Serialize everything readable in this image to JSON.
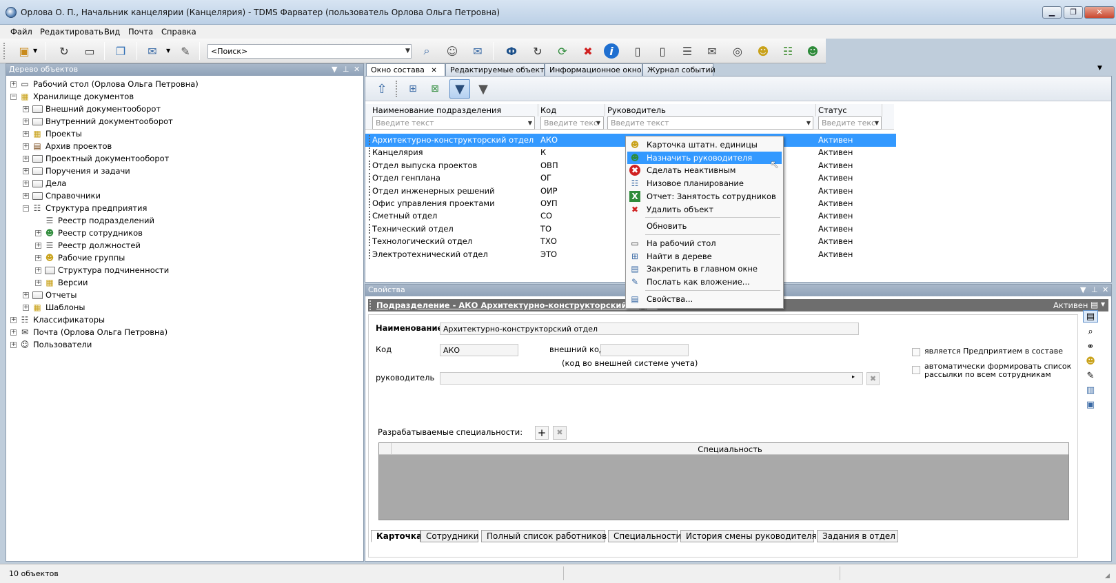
{
  "window": {
    "title": "Орлова О. П., Начальник канцелярии (Канцелярия) - TDMS Фарватер (пользователь Орлова Ольга Петровна)",
    "minimize": "▁",
    "maximize": "❐",
    "close": "✕"
  },
  "menu": [
    "Файл",
    "Редактировать",
    "Вид",
    "Почта",
    "Справка"
  ],
  "toolbar": {
    "search_placeholder": "<Поиск>",
    "icons": [
      "new-object-icon",
      "refresh-icon",
      "desktop-icon",
      "copy-object-icon",
      "send-mail-icon",
      "attach-icon",
      "search-objects-icon",
      "find-user-icon",
      "mail-search-icon",
      "faravter-logo-icon",
      "reload-icon",
      "users-sync-icon",
      "cancel-icon",
      "info-icon",
      "document-icon",
      "page-icon",
      "message-icon",
      "envelope-icon",
      "globe-icon",
      "users-icon",
      "tree-structure-icon",
      "user-profile-icon"
    ]
  },
  "left_panel": {
    "title": "Дерево объектов",
    "tree": [
      {
        "label": "Рабочий стол (Орлова Ольга Петровна)",
        "level": 0,
        "exp": "+",
        "icon": "desktop-icon"
      },
      {
        "label": "Хранилище документов",
        "level": 0,
        "exp": "−",
        "icon": "storage-icon"
      },
      {
        "label": "Внешний документооборот",
        "level": 1,
        "exp": "+",
        "icon": "folder-icon"
      },
      {
        "label": "Внутренний документооборот",
        "level": 1,
        "exp": "+",
        "icon": "folder-icon"
      },
      {
        "label": "Проекты",
        "level": 1,
        "exp": "+",
        "icon": "projects-icon"
      },
      {
        "label": "Архив проектов",
        "level": 1,
        "exp": "+",
        "icon": "archive-icon"
      },
      {
        "label": "Проектный документооборот",
        "level": 1,
        "exp": "+",
        "icon": "folder-icon"
      },
      {
        "label": "Поручения и задачи",
        "level": 1,
        "exp": "+",
        "icon": "folder-icon"
      },
      {
        "label": "Дела",
        "level": 1,
        "exp": "+",
        "icon": "folder-icon"
      },
      {
        "label": "Справочники",
        "level": 1,
        "exp": "+",
        "icon": "folder-icon"
      },
      {
        "label": "Структура предприятия",
        "level": 1,
        "exp": "−",
        "icon": "org-structure-icon"
      },
      {
        "label": "Реестр подразделений",
        "level": 2,
        "exp": "",
        "icon": "registry-icon"
      },
      {
        "label": "Реестр сотрудников",
        "level": 2,
        "exp": "+",
        "icon": "employees-icon"
      },
      {
        "label": "Реестр должностей",
        "level": 2,
        "exp": "+",
        "icon": "positions-icon"
      },
      {
        "label": "Рабочие группы",
        "level": 2,
        "exp": "+",
        "icon": "workgroups-icon"
      },
      {
        "label": "Структура подчиненности",
        "level": 2,
        "exp": "+",
        "icon": "folder-icon"
      },
      {
        "label": "Версии",
        "level": 2,
        "exp": "+",
        "icon": "versions-icon"
      },
      {
        "label": "Отчеты",
        "level": 1,
        "exp": "+",
        "icon": "folder-icon"
      },
      {
        "label": "Шаблоны",
        "level": 1,
        "exp": "+",
        "icon": "templates-icon"
      },
      {
        "label": "Классификаторы",
        "level": 0,
        "exp": "+",
        "icon": "classifier-icon"
      },
      {
        "label": "Почта (Орлова Ольга Петровна)",
        "level": 0,
        "exp": "+",
        "icon": "mail-icon"
      },
      {
        "label": "Пользователи",
        "level": 0,
        "exp": "+",
        "icon": "user-icon"
      }
    ]
  },
  "tabs": [
    "Окно состава",
    "Редактируемые объекты",
    "Информационное окно",
    "Журнал событий"
  ],
  "grid": {
    "columns": [
      "Наименование подразделения",
      "Код",
      "Руководитель",
      "Статус"
    ],
    "filter_placeholder": "Введите текст",
    "filter_placeholder_short": "Введите текс",
    "rows": [
      {
        "name": "Архитектурно-конструкторский отдел",
        "code": "АКО",
        "status": "Активен"
      },
      {
        "name": "Канцелярия",
        "code": "К",
        "status": "Активен"
      },
      {
        "name": "Отдел выпуска проектов",
        "code": "ОВП",
        "status": "Активен"
      },
      {
        "name": "Отдел генплана",
        "code": "ОГ",
        "status": "Активен"
      },
      {
        "name": "Отдел инженерных решений",
        "code": "ОИР",
        "status": "Активен"
      },
      {
        "name": "Офис управления проектами",
        "code": "ОУП",
        "status": "Активен"
      },
      {
        "name": "Сметный отдел",
        "code": "СО",
        "status": "Активен"
      },
      {
        "name": "Технический отдел",
        "code": "ТО",
        "status": "Активен"
      },
      {
        "name": "Технологический отдел",
        "code": "ТХО",
        "status": "Активен"
      },
      {
        "name": "Электротехнический отдел",
        "code": "ЭТО",
        "status": "Активен"
      }
    ]
  },
  "context_menu": {
    "items": [
      {
        "label": "Карточка штатн. единицы",
        "icon": "staff-card-icon"
      },
      {
        "label": "Назначить руководителя",
        "icon": "assign-manager-icon",
        "highlighted": true
      },
      {
        "label": "Сделать неактивным",
        "icon": "deactivate-icon"
      },
      {
        "label": "Низовое планирование",
        "icon": "planning-icon"
      },
      {
        "label": "Отчет: Занятость сотрудников",
        "icon": "excel-report-icon"
      },
      {
        "label": "Удалить объект",
        "icon": "delete-icon"
      },
      {
        "separator": true
      },
      {
        "label": "Обновить",
        "icon": ""
      },
      {
        "separator": true
      },
      {
        "label": "На рабочий стол",
        "icon": "to-desktop-icon"
      },
      {
        "label": "Найти в дереве",
        "icon": "find-in-tree-icon"
      },
      {
        "label": "Закрепить в главном окне",
        "icon": "pin-icon"
      },
      {
        "label": "Послать как вложение...",
        "icon": "send-attachment-icon"
      },
      {
        "separator": true
      },
      {
        "label": "Свойства...",
        "icon": "properties-icon"
      }
    ]
  },
  "properties": {
    "title": "Свойства",
    "subheader": "Подразделение - АКО Архитектурно-конструкторский отдел",
    "status": "Активен",
    "name_label": "Наименование",
    "name_value": "Архитектурно-конструкторский отдел",
    "code_label": "Код",
    "code_value": "АКО",
    "external_code_label": "внешний код",
    "external_code_hint": "(код во внешней системе учета)",
    "manager_label": "руководитель",
    "is_enterprise_label": "является Предприятием в составе",
    "auto_mailing_label": "автоматически формировать список рассылки по всем сотрудникам",
    "specialties_label": "Разрабатываемые специальности:",
    "specialty_column": "Специальность",
    "bottom_tabs": [
      "Карточка",
      "Сотрудники",
      "Полный список работников",
      "Специальности",
      "История смены руководителя",
      "Задания в отдел"
    ]
  },
  "status_bar": {
    "text": "10 объектов"
  }
}
